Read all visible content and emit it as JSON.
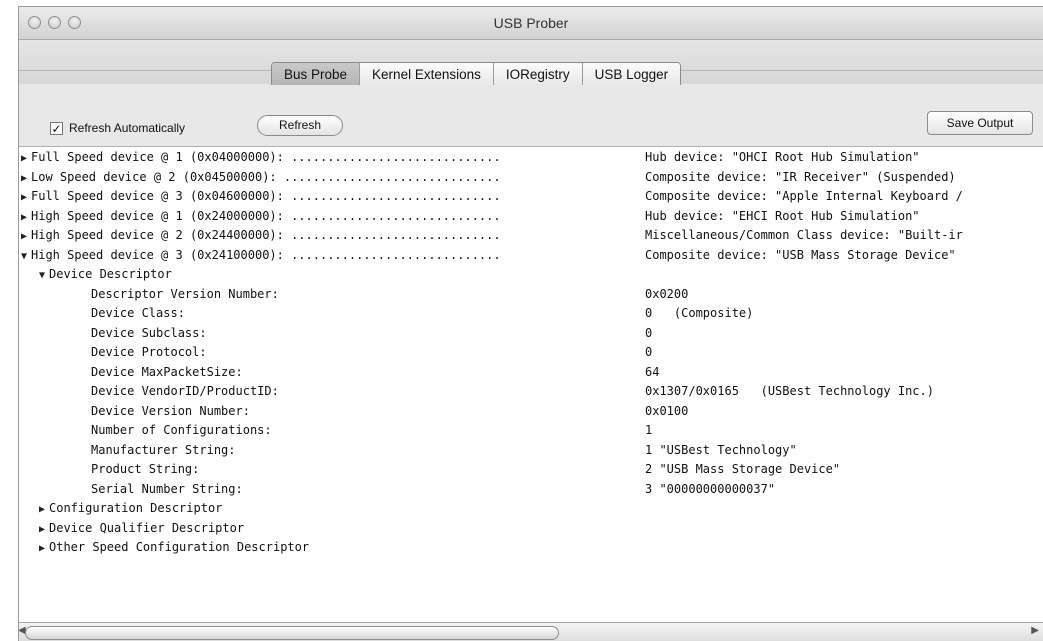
{
  "window": {
    "title": "USB Prober"
  },
  "tabs": [
    {
      "label": "Bus Probe",
      "active": true
    },
    {
      "label": "Kernel Extensions",
      "active": false
    },
    {
      "label": "IORegistry",
      "active": false
    },
    {
      "label": "USB Logger",
      "active": false
    }
  ],
  "controls": {
    "refresh_auto_label": "Refresh Automatically",
    "refresh_auto_checked": true,
    "refresh_button": "Refresh",
    "save_button": "Save Output"
  },
  "devices": [
    {
      "name": "Full Speed device @ 1 (0x04000000): .............................",
      "value": "Hub device: \"OHCI Root Hub Simulation\"",
      "expanded": false
    },
    {
      "name": "Low Speed device @ 2 (0x04500000): ..............................",
      "value": "Composite device: \"IR Receiver\" (Suspended)",
      "expanded": false
    },
    {
      "name": "Full Speed device @ 3 (0x04600000): .............................",
      "value": "Composite device: \"Apple Internal Keyboard /",
      "expanded": false
    },
    {
      "name": "High Speed device @ 1 (0x24000000): .............................",
      "value": "Hub device: \"EHCI Root Hub Simulation\"",
      "expanded": false
    },
    {
      "name": "High Speed device @ 2 (0x24400000): .............................",
      "value": "Miscellaneous/Common Class device: \"Built-ir",
      "expanded": false
    },
    {
      "name": "High Speed device @ 3 (0x24100000): .............................",
      "value": "Composite device: \"USB Mass Storage Device\"",
      "expanded": true
    }
  ],
  "device_descriptor": {
    "label": "Device Descriptor",
    "fields": [
      {
        "key": "Descriptor Version Number:",
        "value": "0x0200"
      },
      {
        "key": "Device Class:",
        "value": "0   (Composite)"
      },
      {
        "key": "Device Subclass:",
        "value": "0"
      },
      {
        "key": "Device Protocol:",
        "value": "0"
      },
      {
        "key": "Device MaxPacketSize:",
        "value": "64"
      },
      {
        "key": "Device VendorID/ProductID:",
        "value": "0x1307/0x0165   (USBest Technology Inc.)"
      },
      {
        "key": "Device Version Number:",
        "value": "0x0100"
      },
      {
        "key": "Number of Configurations:",
        "value": "1"
      },
      {
        "key": "Manufacturer String:",
        "value": "1 \"USBest Technology\""
      },
      {
        "key": "Product String:",
        "value": "2 \"USB Mass Storage Device\""
      },
      {
        "key": "Serial Number String:",
        "value": "3 \"00000000000037\""
      }
    ]
  },
  "collapsed_sections": [
    "Configuration Descriptor",
    "Device Qualifier Descriptor",
    "Other Speed Configuration Descriptor"
  ],
  "glyphs": {
    "collapsed": "▶",
    "expanded": "▼",
    "check": "✓",
    "scroll_left": "◀",
    "scroll_right": "▶"
  }
}
